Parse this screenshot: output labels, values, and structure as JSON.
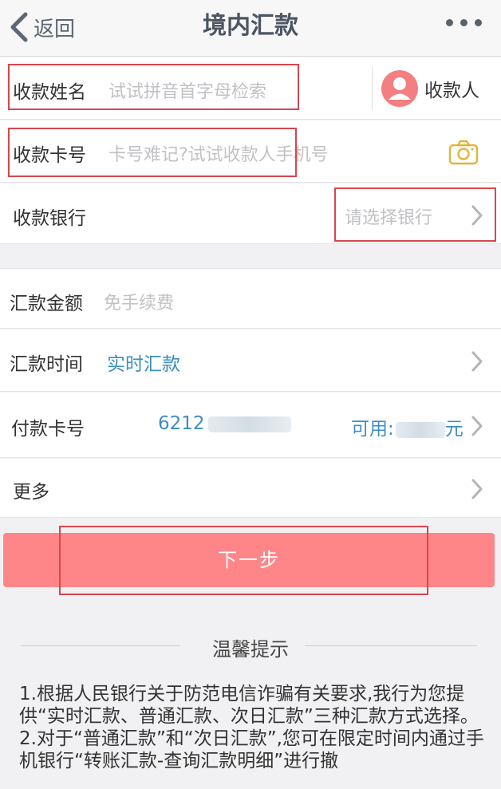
{
  "header": {
    "back_label": "返回",
    "title": "境内汇款"
  },
  "payee_name": {
    "label": "收款姓名",
    "placeholder": "试试拼音首字母检索",
    "contact_label": "收款人"
  },
  "payee_card": {
    "label": "收款卡号",
    "placeholder": "卡号难记?试试收款人手机号"
  },
  "payee_bank": {
    "label": "收款银行",
    "placeholder": "请选择银行"
  },
  "amount": {
    "label": "汇款金额",
    "placeholder": "免手续费"
  },
  "time": {
    "label": "汇款时间",
    "value": "实时汇款"
  },
  "pay_card": {
    "label": "付款卡号",
    "card_prefix": "6212",
    "available_label": "可用:",
    "available_unit": "元"
  },
  "more": {
    "label": "更多"
  },
  "next_button": {
    "label": "下一步"
  },
  "tips": {
    "title": "温馨提示",
    "lines": [
      "1.根据人民银行关于防范电信诈骗有关要求,我行为您提供“实时汇款、普通汇款、次日汇款”三种汇款方式选择。",
      "2.对于“普通汇款”和“次日汇款”,您可在限定时间内通过手机银行“转账汇款-查询汇款明细”进行撤"
    ]
  },
  "colors": {
    "accent_blue": "#3b8fc1",
    "button_red": "#ff8688",
    "highlight_box": "#d8464f",
    "placeholder_gray": "#c2c2c6"
  }
}
